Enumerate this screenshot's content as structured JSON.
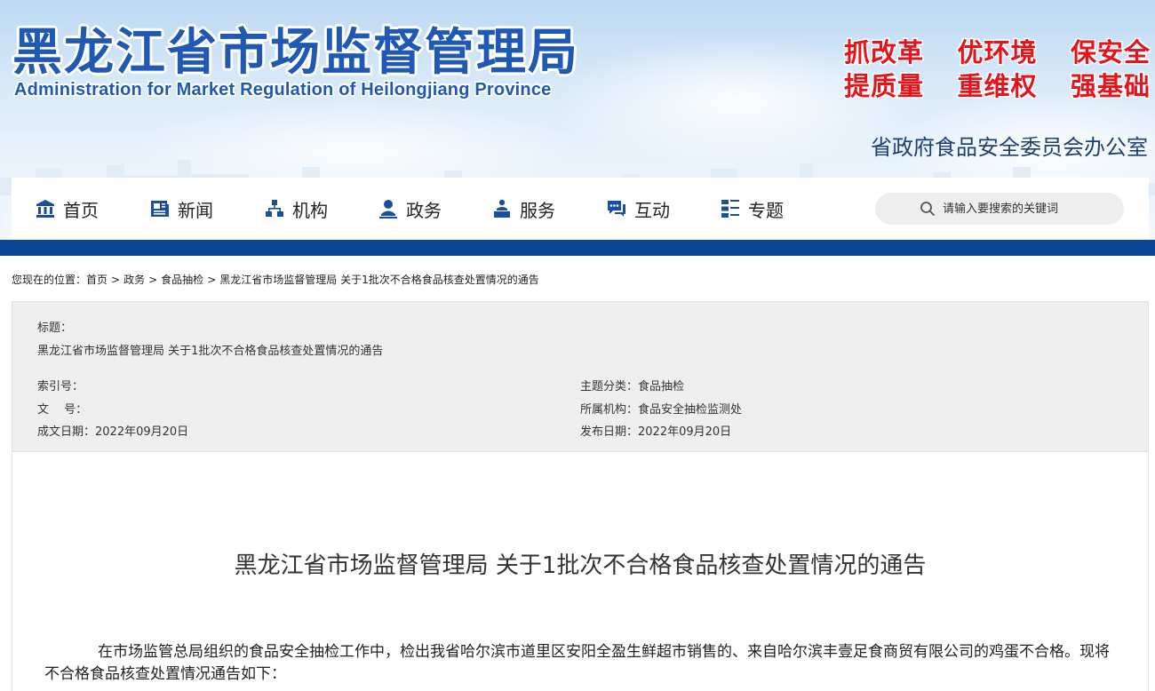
{
  "header": {
    "title_cn": "黑龙江省市场监督管理局",
    "title_en": "Administration for Market Regulation of Heilongjiang Province",
    "slogans": [
      [
        "抓改革",
        "优环境",
        "保安全"
      ],
      [
        "提质量",
        "重维权",
        "强基础"
      ]
    ],
    "office": "省政府食品安全委员会办公室",
    "colors": {
      "title": "#1f59b3",
      "slogan": "#e3141b",
      "strip": "#0c4594"
    }
  },
  "nav": {
    "items": [
      {
        "label": "首页",
        "icon": "bank-icon"
      },
      {
        "label": "新闻",
        "icon": "newspaper-icon"
      },
      {
        "label": "机构",
        "icon": "org-chart-icon"
      },
      {
        "label": "政务",
        "icon": "official-icon"
      },
      {
        "label": "服务",
        "icon": "service-icon"
      },
      {
        "label": "互动",
        "icon": "chat-icon"
      },
      {
        "label": "专题",
        "icon": "topics-icon"
      }
    ],
    "search": {
      "placeholder": "请输入要搜索的关键词"
    }
  },
  "breadcrumb": {
    "prefix": "您现在的位置：",
    "items": [
      "首页",
      "政务",
      "食品抽检",
      "黑龙江省市场监督管理局 关于1批次不合格食品核查处置情况的通告"
    ],
    "separator": ">"
  },
  "meta": {
    "title_label": "标题：",
    "title_value": "黑龙江省市场监督管理局 关于1批次不合格食品核查处置情况的通告",
    "index_label": "索引号：",
    "index_value": "",
    "doc_label": "文　 号：",
    "doc_value": "",
    "created_label": "成文日期：",
    "created_value": "2022年09月20日",
    "category_label": "主题分类：",
    "category_value": "食品抽检",
    "org_label": "所属机构：",
    "org_value": "食品安全抽检监测处",
    "published_label": "发布日期：",
    "published_value": "2022年09月20日"
  },
  "article": {
    "title": "黑龙江省市场监督管理局 关于1批次不合格食品核查处置情况的通告",
    "paragraph": "在市场监管总局组织的食品安全抽检工作中，检出我省哈尔滨市道里区安阳全盈生鲜超市销售的、来自哈尔滨丰壹足食商贸有限公司的鸡蛋不合格。现将不合格食品核查处置情况通告如下："
  }
}
